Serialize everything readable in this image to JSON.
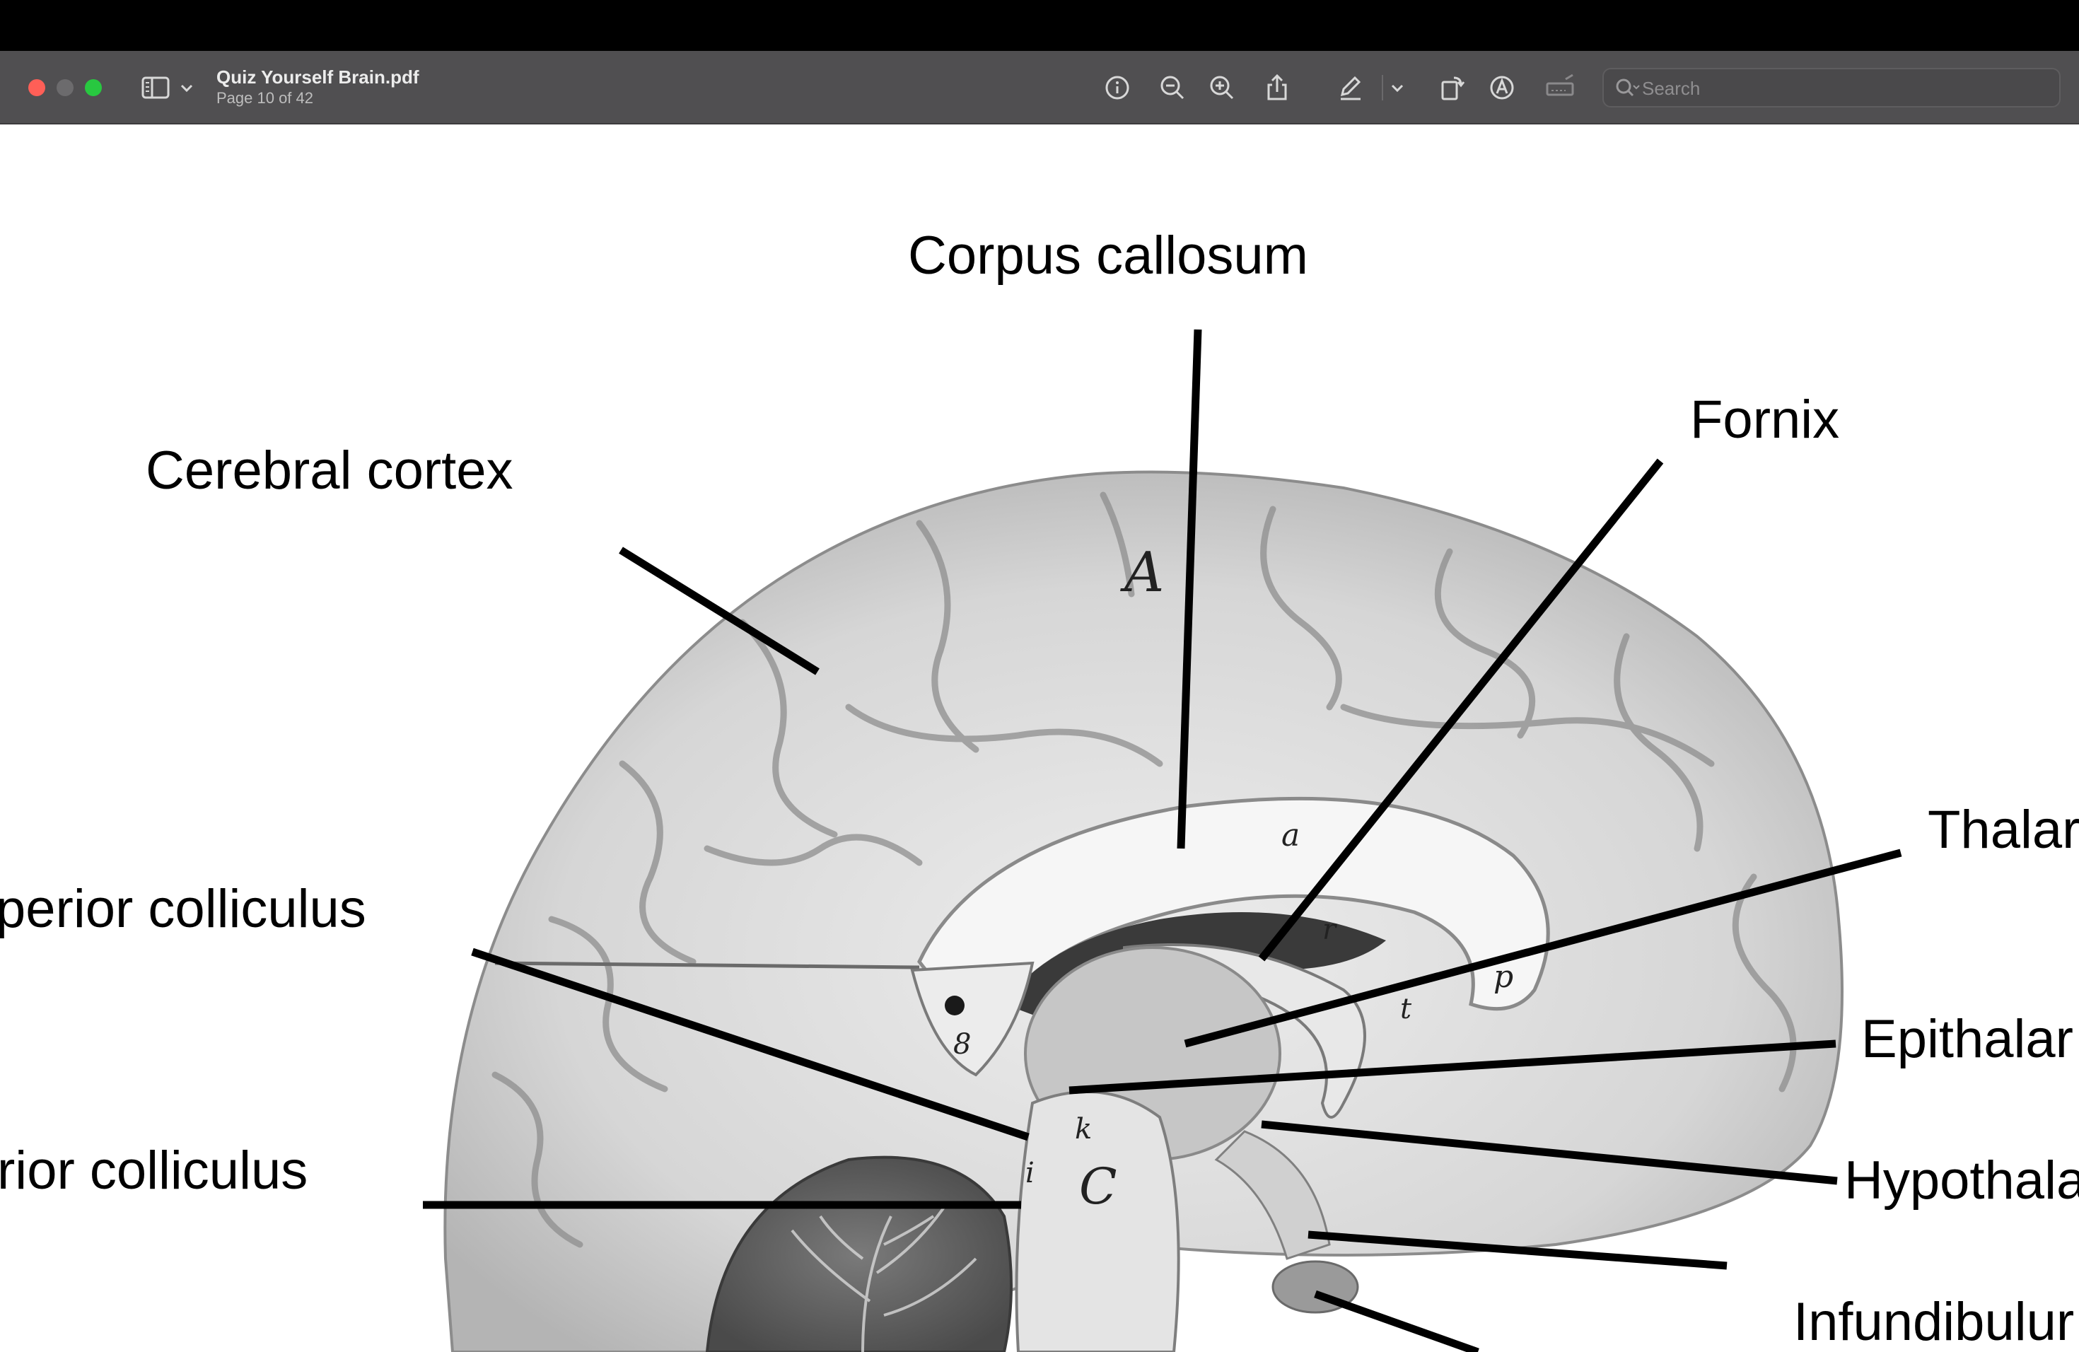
{
  "window": {
    "title": "Quiz Yourself Brain.pdf",
    "subtitle": "Page 10 of 42",
    "search_placeholder": "Search"
  },
  "toolbar": {
    "icons": [
      "sidebar-icon",
      "chevron-down-icon",
      "info-icon",
      "zoom-out-icon",
      "zoom-in-icon",
      "share-icon",
      "markup-pen-icon",
      "chevron-down-icon",
      "rotate-icon",
      "annotate-icon",
      "form-fill-icon",
      "search-icon"
    ]
  },
  "document": {
    "labels": {
      "corpus_callosum": "Corpus callosum",
      "cerebral_cortex": "Cerebral cortex",
      "fornix": "Fornix",
      "thalamus": "Thalar",
      "superior_colliculus": "perior colliculus",
      "epithalamus": "Epithalar",
      "inferior_colliculus": "rior colliculus",
      "hypothalamus": "Hypothala",
      "infundibulum": "Infundibulur"
    },
    "markers": [
      "A",
      "a",
      "r",
      "C",
      "k",
      "i",
      "8",
      "p",
      "t"
    ]
  },
  "colors": {
    "titlebar": "#504f51",
    "close": "#ff5f57",
    "minimize": "#6c6b6d",
    "maximize": "#28c840"
  }
}
